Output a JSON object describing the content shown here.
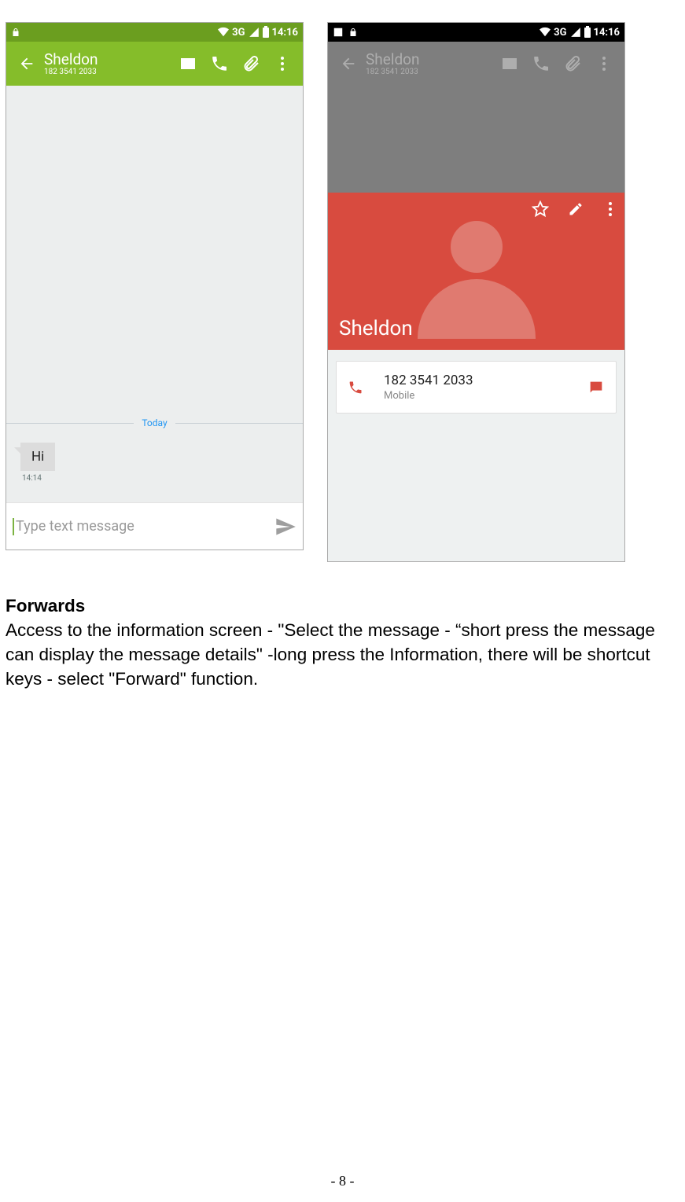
{
  "status": {
    "network": "3G",
    "time": "14:16"
  },
  "left": {
    "appbar": {
      "name": "Sheldon",
      "number": "182 3541 2033"
    },
    "divider_label": "Today",
    "message": {
      "text": "Hi",
      "time": "14:14"
    },
    "compose_placeholder": "Type text message"
  },
  "right": {
    "appbar": {
      "name": "Sheldon",
      "number": "182 3541 2033"
    },
    "contact": {
      "name": "Sheldon",
      "phone": "182 3541 2033",
      "type": "Mobile"
    }
  },
  "doc": {
    "heading": "Forwards",
    "body": "Access to the information screen - \"Select the message - “short press the message can display the message details\" -long press the Information, there will be shortcut keys - select \"Forward\" function."
  },
  "page_number": "- 8 -"
}
